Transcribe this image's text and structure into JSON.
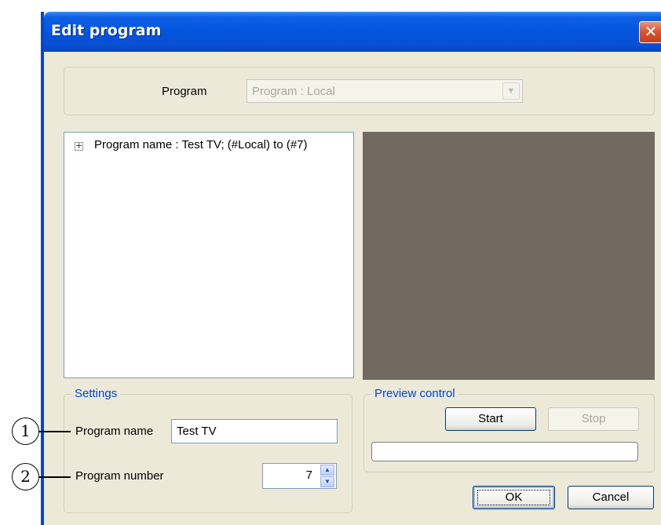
{
  "window": {
    "title": "Edit program",
    "close_glyph": "✕"
  },
  "program_selector": {
    "label": "Program",
    "value": "Program : Local",
    "enabled": false
  },
  "tree": {
    "items": [
      {
        "label": "Program name : Test TV; (#Local) to (#7)",
        "expander": "+"
      }
    ]
  },
  "settings": {
    "caption": "Settings",
    "program_name_label": "Program name",
    "program_name_value": "Test TV",
    "program_number_label": "Program number",
    "program_number_value": "7"
  },
  "preview_control": {
    "caption": "Preview control",
    "start_label": "Start",
    "stop_label": "Stop",
    "progress": 0
  },
  "buttons": {
    "ok_label": "OK",
    "cancel_label": "Cancel"
  },
  "callouts": [
    "1",
    "2"
  ],
  "icons": {
    "close": "close-icon",
    "combo_arrow": "chevron-down-icon",
    "tree_expander": "plus-box-icon",
    "spin_up": "arrow-up-icon",
    "spin_down": "arrow-down-icon"
  },
  "colors": {
    "titlebar": "#0456e0",
    "dialog_bg": "#ece9d8",
    "group_caption": "#0046d5",
    "preview_bg": "#726a61",
    "close_button": "#d9512c"
  }
}
